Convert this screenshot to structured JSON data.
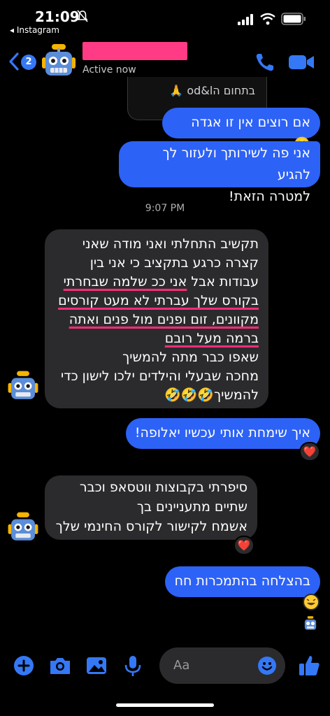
{
  "status_bar": {
    "time": "21:09",
    "back_app": "◂ Instagram"
  },
  "header": {
    "unread_count": "2",
    "active_status": "Active now"
  },
  "messages": {
    "quoted_tail": "בתחום הod&l 🙏",
    "m1": "אם רוצים אין זו אגדה 🙂",
    "m2_line1": "אני פה לשירותך ולעזור לך להגיע",
    "m2_line2": "למטרה הזאת!",
    "timestamp": "9:07 PM",
    "m3": {
      "l1": "תקשיב התחלתי ואני מודה שאני",
      "l2": "קצרה כרגע בתקציב כי אני בין",
      "l3a": "עבודות אבל ",
      "l3b": "אני ככ שלמה שבחרתי",
      "l4": "בקורס שלך עברתי לא מעט קורסים",
      "l5": "מקוונים, זום ופנים מול פנים ואתה",
      "l6": "ברמה מעל רובם",
      "l7": "שאפו כבר מתה להמשיך",
      "l8": "מחכה שבעלי והילדים ילכו לישון כדי",
      "l9": "להמשיך🤣🤣🤣"
    },
    "m4": "איך שימחת אותי עכשיו יאלופה!",
    "m5": {
      "l1": "סיפרתי בקבוצות ווטסאפ וכבר",
      "l2": "שתיים מתעניינים בך",
      "l3": "אשמח לקישור לקורס החינמי שלך"
    },
    "m6": "בהצלחה בהתמכרות חח",
    "heart": "❤️"
  },
  "composer": {
    "placeholder": "Aa"
  },
  "colors": {
    "accent": "#2d62f6",
    "incoming": "#2b2b2d",
    "underline": "#ff2d78",
    "redaction": "#ff3b86"
  },
  "icons": [
    "bell-slash-icon",
    "signal-icon",
    "wifi-icon",
    "battery-icon",
    "chevron-left-icon",
    "robot-avatar-icon",
    "phone-icon",
    "video-icon",
    "plus-icon",
    "camera-icon",
    "image-icon",
    "microphone-icon",
    "emoji-icon",
    "thumbs-up-icon"
  ]
}
